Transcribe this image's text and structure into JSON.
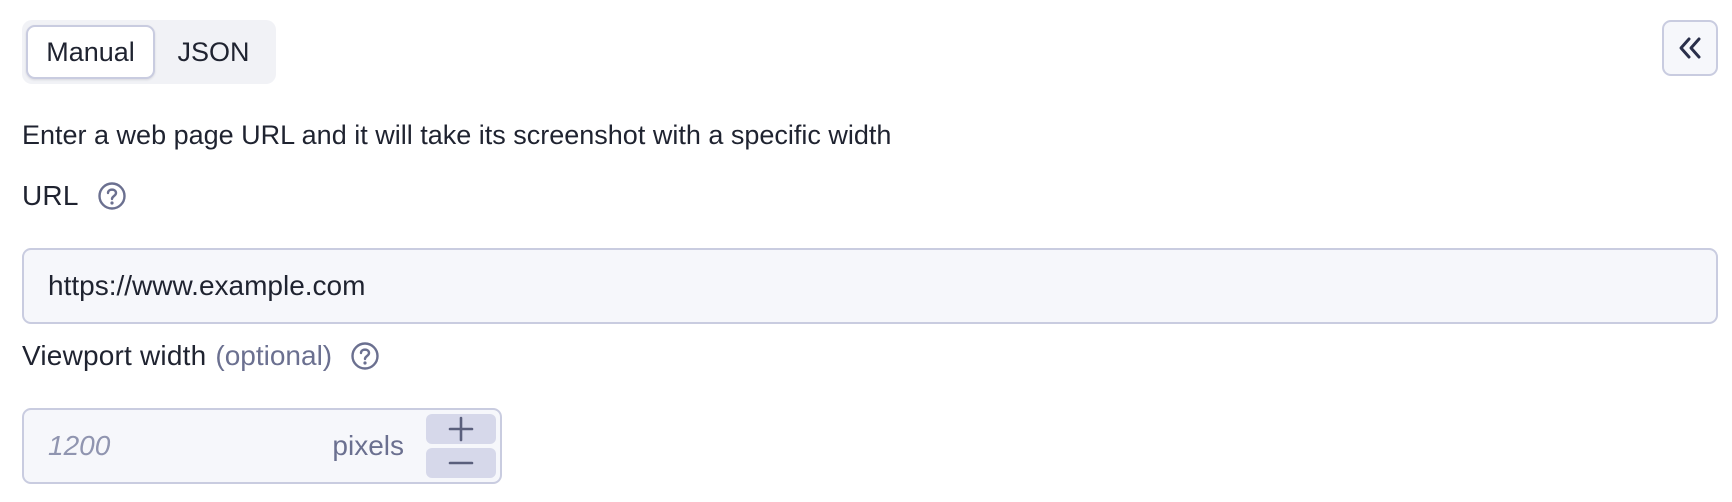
{
  "mode_toggle": {
    "manual_label": "Manual",
    "json_label": "JSON",
    "active": "Manual"
  },
  "collapse_button": {
    "icon": "double-chevron-left-icon"
  },
  "description": "Enter a web page URL and it will take its screenshot with a specific width",
  "url_field": {
    "label": "URL",
    "value": "https://www.example.com",
    "help_icon": "question-circle-icon"
  },
  "viewport_field": {
    "label": "Viewport width",
    "optional_label": "(optional)",
    "placeholder": "1200",
    "unit": "pixels",
    "help_icon": "question-circle-icon",
    "increment_icon": "plus-icon",
    "decrement_icon": "minus-icon"
  },
  "colors": {
    "border": "#c9cce0",
    "input_bg": "#f6f7fb",
    "text": "#1f2330",
    "muted": "#6b7090",
    "stepper_bg": "#d6d8ea"
  }
}
